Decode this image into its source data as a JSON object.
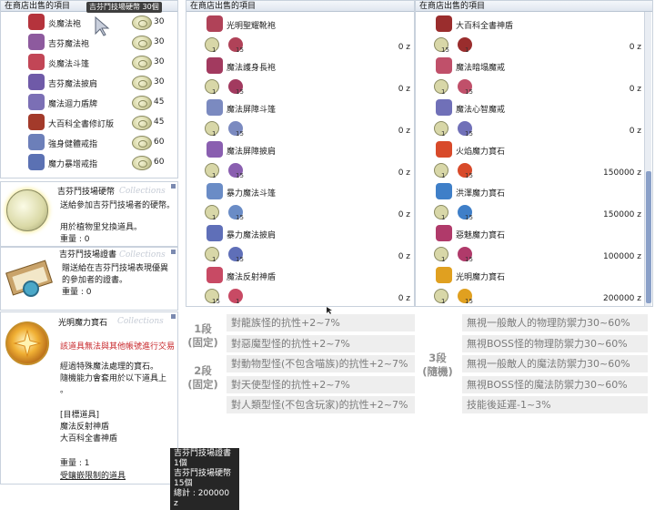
{
  "shop_left": {
    "title": "在商店出售的項目",
    "currency_badge": "吉芬鬥技場硬幣 30個",
    "items": [
      {
        "name": "炎魔法袍",
        "price": "30",
        "icon": "red-robe-icon",
        "color": "#b5333c"
      },
      {
        "name": "吉芬魔法袍",
        "price": "30",
        "icon": "purple-robe-icon",
        "color": "#8d5a9e"
      },
      {
        "name": "炎魔法斗篷",
        "price": "30",
        "icon": "red-cape-icon",
        "color": "#c24656"
      },
      {
        "name": "吉芬魔法披肩",
        "price": "30",
        "icon": "purple-shawl-icon",
        "color": "#6f5aa8"
      },
      {
        "name": "魔法迴力盾牌",
        "price": "45",
        "icon": "shield-icon",
        "color": "#7b6fb5"
      },
      {
        "name": "大百科全書修訂版",
        "price": "45",
        "icon": "book-icon",
        "color": "#a33a2a"
      },
      {
        "name": "強身健體戒指",
        "price": "60",
        "icon": "ring-icon",
        "color": "#6c7fb9"
      },
      {
        "name": "魔力暴增戒指",
        "price": "60",
        "icon": "ring-icon",
        "color": "#5b71b3"
      }
    ]
  },
  "card_coin": {
    "title": "吉芬鬥技場硬幣",
    "text": "送給參加吉芬鬥技場者的硬幣。",
    "text2": "用於植物里兌換道具。",
    "weight": "重量 : 0",
    "watermark": "Collections"
  },
  "card_cert": {
    "title": "吉芬鬥技場證書",
    "text1": "贈送給在吉芬鬥技場表現優異",
    "text2": "的參加者的證書。",
    "weight": "重量 : 0",
    "watermark": "Collections"
  },
  "card_gem": {
    "title": "光明魔力寶石",
    "watermark": "Collections",
    "warning": "該道具無法與其他帳號進行交易",
    "line1": "經過特殊魔法處理的寶石。",
    "line2": "隨機能力會套用於以下道具上",
    "line3": "。",
    "target_header": "[目標道具]",
    "target1": "魔法反射神盾",
    "target2": "大百科全書神盾",
    "weight": "重量 : 1",
    "restriction": "受鑲嵌限制的道具"
  },
  "summary_tooltip": {
    "line1": "吉芬鬥技場證書 1個",
    "line2": "吉芬鬥技場硬幣 15個",
    "line3": "總計 : 200000 z"
  },
  "shop_mid": {
    "title": "在商店出售的項目",
    "items": [
      {
        "name": "光明聖耀靴袍",
        "price": "0 z",
        "c1": "1",
        "c2": "15",
        "color": "#b04258"
      },
      {
        "name": "魔法護身長袍",
        "price": "0 z",
        "c1": "1",
        "c2": "15",
        "color": "#a23a5f"
      },
      {
        "name": "魔法屏障斗篷",
        "price": "0 z",
        "c1": "1",
        "c2": "15",
        "color": "#7b8ac0"
      },
      {
        "name": "魔法屏障披肩",
        "price": "0 z",
        "c1": "1",
        "c2": "15",
        "color": "#8a5fb0"
      },
      {
        "name": "暴力魔法斗篷",
        "price": "0 z",
        "c1": "1",
        "c2": "15",
        "color": "#6a8cc6"
      },
      {
        "name": "暴力魔法披肩",
        "price": "0 z",
        "c1": "1",
        "c2": "15",
        "color": "#5f6fb8"
      },
      {
        "name": "魔法反射神盾",
        "price": "0 z",
        "c1": "15",
        "c2": "1",
        "color": "#c84a64"
      }
    ]
  },
  "shop_right": {
    "title": "在商店出售的項目",
    "items": [
      {
        "name": "大百科全書神盾",
        "price": "0 z",
        "c1": "15",
        "c2": "1",
        "color": "#9a2d2d"
      },
      {
        "name": "魔法暗塌魔戒",
        "price": "0 z",
        "c1": "1",
        "c2": "15",
        "color": "#c0506a"
      },
      {
        "name": "魔法心智魔戒",
        "price": "0 z",
        "c1": "1",
        "c2": "15",
        "color": "#7070b8"
      },
      {
        "name": "火焰魔力寶石",
        "price": "150000 z",
        "c1": "1",
        "c2": "15",
        "color": "#d84a2a"
      },
      {
        "name": "洪澤魔力寶石",
        "price": "150000 z",
        "c1": "1",
        "c2": "15",
        "color": "#3f7fc8"
      },
      {
        "name": "惡魅魔力寶石",
        "price": "100000 z",
        "c1": "1",
        "c2": "15",
        "color": "#b03a6a"
      },
      {
        "name": "光明魔力寶石",
        "price": "200000 z",
        "c1": "1",
        "c2": "15",
        "color": "#e0a020"
      }
    ]
  },
  "stats": {
    "stage1": "1段\n(固定)",
    "stage2": "2段\n(固定)",
    "stage3": "3段\n(隨機)",
    "left": [
      "對龍族怪的抗性+2~7%",
      "對惡魔型怪的抗性+2~7%",
      "對動物型怪(不包含喵族)的抗性+2~7%",
      "對天使型怪的抗性+2~7%",
      "對人類型怪(不包含玩家)的抗性+2~7%"
    ],
    "right": [
      "無視一般敵人的物理防禦力30~60%",
      "無視BOSS怪的物理防禦力30~60%",
      "無視一般敵人的魔法防禦力30~60%",
      "無視BOSS怪的魔法防禦力30~60%",
      "技能後延遲-1~3%"
    ]
  }
}
